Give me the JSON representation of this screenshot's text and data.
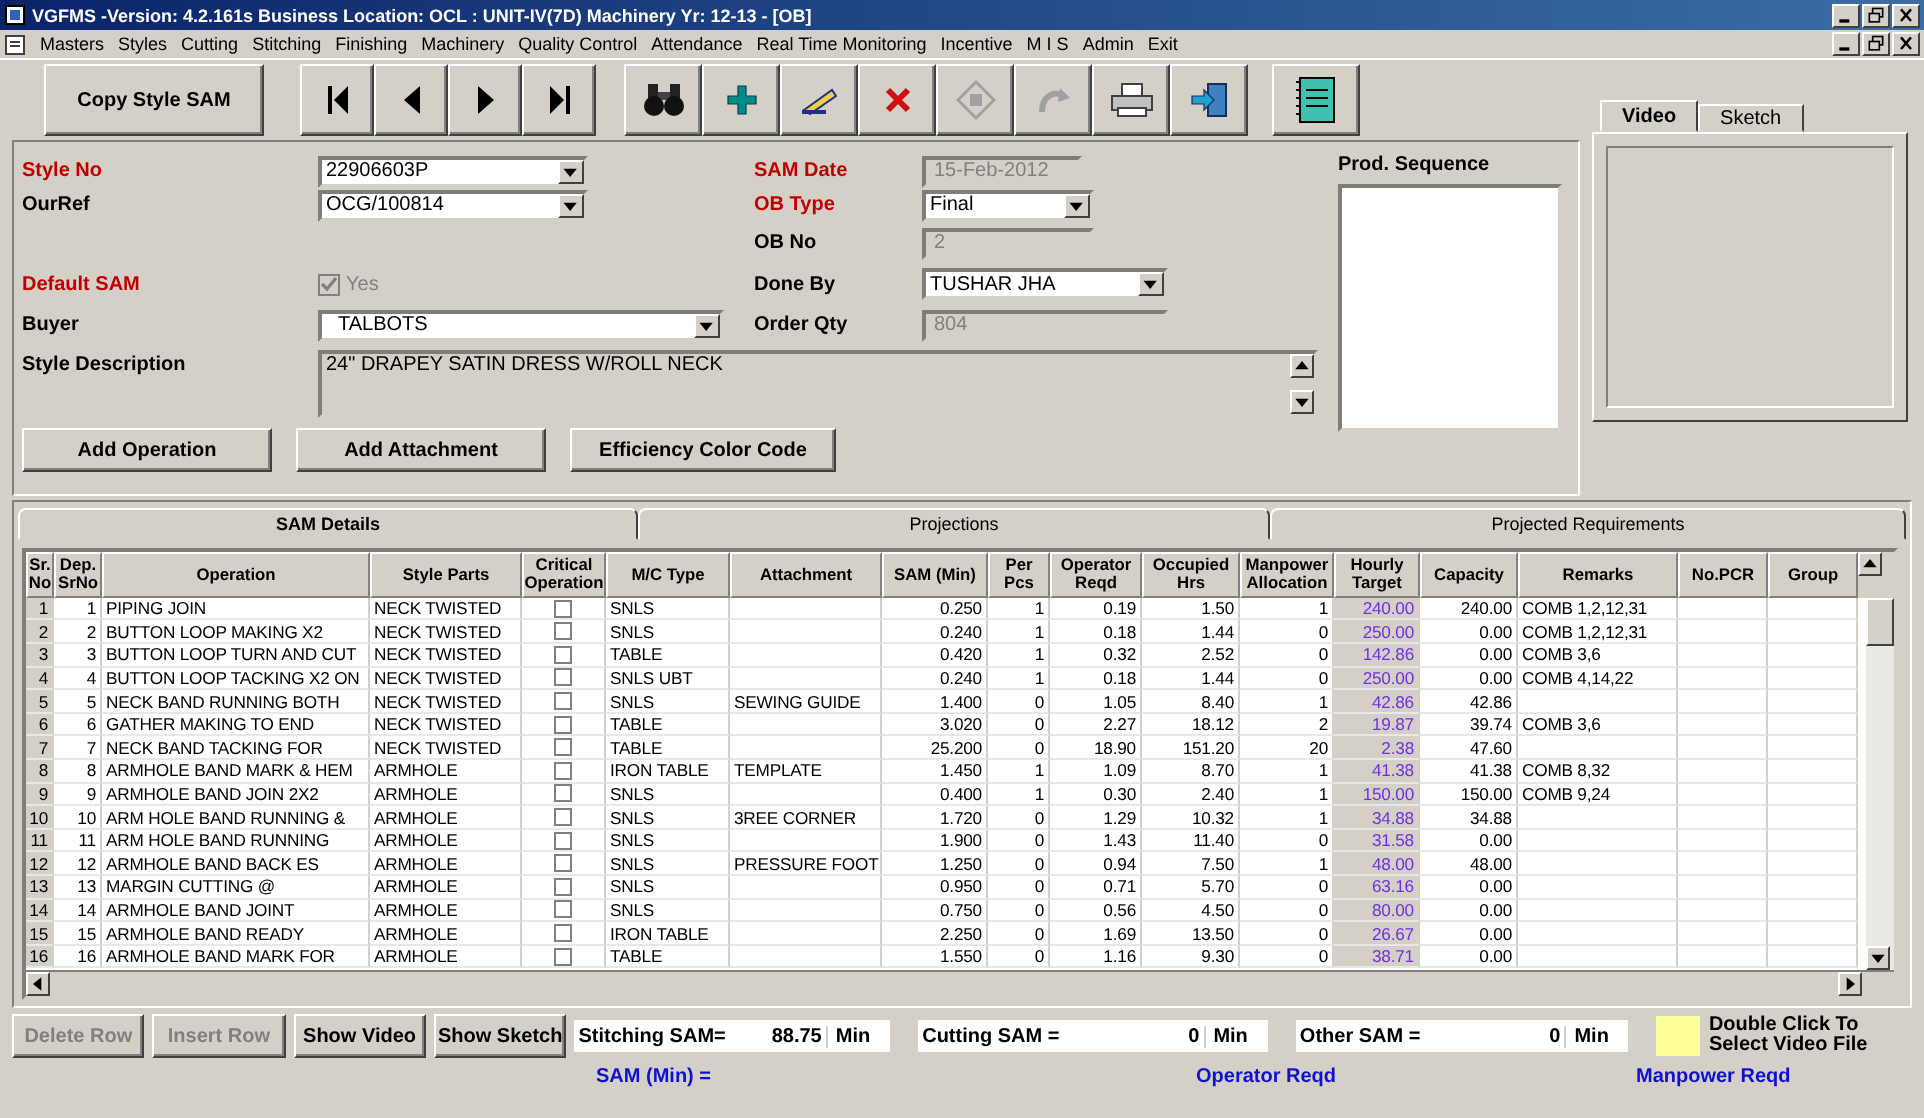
{
  "window": {
    "title": "VGFMS -Version: 4.2.161s Business Location: OCL : UNIT-IV(7D)  Machinery Yr: 12-13  - [OB]"
  },
  "menu": [
    "Masters",
    "Styles",
    "Cutting",
    "Stitching",
    "Finishing",
    "Machinery",
    "Quality Control",
    "Attendance",
    "Real Time Monitoring",
    "Incentive",
    "M I S",
    "Admin",
    "Exit"
  ],
  "toolbar": {
    "copy_button": "Copy Style SAM",
    "nav": [
      {
        "kind": "first"
      },
      {
        "kind": "prev"
      },
      {
        "kind": "next"
      },
      {
        "kind": "last"
      }
    ],
    "tools": [
      {
        "kind": "find",
        "disabled": false
      },
      {
        "kind": "add",
        "disabled": false
      },
      {
        "kind": "edit",
        "disabled": false
      },
      {
        "kind": "delete",
        "disabled": false
      },
      {
        "kind": "save",
        "disabled": true
      },
      {
        "kind": "undo",
        "disabled": true
      },
      {
        "kind": "print",
        "disabled": false
      },
      {
        "kind": "exit",
        "disabled": false
      }
    ],
    "notes": {
      "kind": "notes"
    }
  },
  "form": {
    "style_no": {
      "label": "Style No",
      "required": true,
      "value": "22906603P"
    },
    "our_ref": {
      "label": "OurRef",
      "required": false,
      "value": "OCG/100814"
    },
    "default_sam": {
      "label": "Default SAM",
      "required": true,
      "checkbox_label": "Yes",
      "checked": true,
      "disabled": true
    },
    "buyer": {
      "label": "Buyer",
      "required": false,
      "value": "TALBOTS"
    },
    "style_description": {
      "label": "Style Description",
      "value": "24\" DRAPEY SATIN DRESS W/ROLL NECK"
    },
    "sam_date": {
      "label": "SAM Date",
      "required": true,
      "value": "15-Feb-2012",
      "disabled": true
    },
    "ob_type": {
      "label": "OB Type",
      "required": true,
      "value": "Final"
    },
    "ob_no": {
      "label": "OB No",
      "required": false,
      "value": "2",
      "disabled": true
    },
    "done_by": {
      "label": "Done By",
      "required": false,
      "value": "TUSHAR JHA"
    },
    "order_qty": {
      "label": "Order Qty",
      "required": false,
      "value": "804",
      "disabled": true
    },
    "prod_sequence": {
      "label": "Prod. Sequence"
    },
    "buttons": [
      "Add Operation",
      "Add Attachment",
      "Efficiency Color Code"
    ]
  },
  "media_tabs": [
    {
      "label": "Video",
      "selected": true
    },
    {
      "label": "Sketch",
      "selected": false
    }
  ],
  "grid_tabs": [
    {
      "label": "SAM Details",
      "selected": true
    },
    {
      "label": "Projections",
      "selected": false
    },
    {
      "label": "Projected Requirements",
      "selected": false
    }
  ],
  "table": {
    "columns": [
      "Sr. No",
      "Dep. SrNo",
      "Operation",
      "Style Parts",
      "Critical Operation",
      "M/C Type",
      "Attachment",
      "SAM (Min)",
      "Per Pcs",
      "Operator Reqd",
      "Occupied Hrs",
      "Manpower Allocation",
      "Hourly Target",
      "Capacity",
      "Remarks",
      "No.PCR",
      "Group"
    ],
    "rows": [
      {
        "sr": "1",
        "dep": "1",
        "operation": "PIPING JOIN",
        "style_parts": "NECK TWISTED",
        "critical": false,
        "mc_type": "SNLS",
        "attachment": "",
        "sam": "0.250",
        "per_pcs": "1",
        "operator_reqd": "0.19",
        "occupied_hrs": "1.50",
        "manpower": "1",
        "hourly_target": "240.00",
        "capacity": "240.00",
        "remarks": "COMB 1,2,12,31"
      },
      {
        "sr": "2",
        "dep": "2",
        "operation": "BUTTON LOOP MAKING X2",
        "style_parts": "NECK TWISTED",
        "critical": false,
        "mc_type": "SNLS",
        "attachment": "",
        "sam": "0.240",
        "per_pcs": "1",
        "operator_reqd": "0.18",
        "occupied_hrs": "1.44",
        "manpower": "0",
        "hourly_target": "250.00",
        "capacity": "0.00",
        "remarks": "COMB 1,2,12,31"
      },
      {
        "sr": "3",
        "dep": "3",
        "operation": "BUTTON LOOP TURN AND CUT",
        "style_parts": "NECK TWISTED",
        "critical": false,
        "mc_type": "TABLE",
        "attachment": "",
        "sam": "0.420",
        "per_pcs": "1",
        "operator_reqd": "0.32",
        "occupied_hrs": "2.52",
        "manpower": "0",
        "hourly_target": "142.86",
        "capacity": "0.00",
        "remarks": "COMB 3,6"
      },
      {
        "sr": "4",
        "dep": "4",
        "operation": "BUTTON LOOP TACKING X2 ON",
        "style_parts": "NECK TWISTED",
        "critical": false,
        "mc_type": "SNLS UBT",
        "attachment": "",
        "sam": "0.240",
        "per_pcs": "1",
        "operator_reqd": "0.18",
        "occupied_hrs": "1.44",
        "manpower": "0",
        "hourly_target": "250.00",
        "capacity": "0.00",
        "remarks": "COMB 4,14,22"
      },
      {
        "sr": "5",
        "dep": "5",
        "operation": "NECK BAND RUNNING BOTH",
        "style_parts": "NECK TWISTED",
        "critical": false,
        "mc_type": "SNLS",
        "attachment": "SEWING GUIDE",
        "sam": "1.400",
        "per_pcs": "0",
        "operator_reqd": "1.05",
        "occupied_hrs": "8.40",
        "manpower": "1",
        "hourly_target": "42.86",
        "capacity": "42.86",
        "remarks": ""
      },
      {
        "sr": "6",
        "dep": "6",
        "operation": "GATHER MAKING TO END",
        "style_parts": "NECK TWISTED",
        "critical": false,
        "mc_type": "TABLE",
        "attachment": "",
        "sam": "3.020",
        "per_pcs": "0",
        "operator_reqd": "2.27",
        "occupied_hrs": "18.12",
        "manpower": "2",
        "hourly_target": "19.87",
        "capacity": "39.74",
        "remarks": "COMB 3,6"
      },
      {
        "sr": "7",
        "dep": "7",
        "operation": "NECK BAND TACKING FOR",
        "style_parts": "NECK TWISTED",
        "critical": false,
        "mc_type": "TABLE",
        "attachment": "",
        "sam": "25.200",
        "per_pcs": "0",
        "operator_reqd": "18.90",
        "occupied_hrs": "151.20",
        "manpower": "20",
        "hourly_target": "2.38",
        "capacity": "47.60",
        "remarks": ""
      },
      {
        "sr": "8",
        "dep": "8",
        "operation": "ARMHOLE BAND MARK & HEM",
        "style_parts": "ARMHOLE",
        "critical": false,
        "mc_type": "IRON TABLE",
        "attachment": "TEMPLATE",
        "sam": "1.450",
        "per_pcs": "1",
        "operator_reqd": "1.09",
        "occupied_hrs": "8.70",
        "manpower": "1",
        "hourly_target": "41.38",
        "capacity": "41.38",
        "remarks": "COMB 8,32"
      },
      {
        "sr": "9",
        "dep": "9",
        "operation": "ARMHOLE BAND JOIN 2X2",
        "style_parts": "ARMHOLE",
        "critical": false,
        "mc_type": "SNLS",
        "attachment": "",
        "sam": "0.400",
        "per_pcs": "1",
        "operator_reqd": "0.30",
        "occupied_hrs": "2.40",
        "manpower": "1",
        "hourly_target": "150.00",
        "capacity": "150.00",
        "remarks": "COMB 9,24"
      },
      {
        "sr": "10",
        "dep": "10",
        "operation": "ARM HOLE BAND RUNNING &",
        "style_parts": "ARMHOLE",
        "critical": false,
        "mc_type": "SNLS",
        "attachment": "3REE CORNER",
        "sam": "1.720",
        "per_pcs": "0",
        "operator_reqd": "1.29",
        "occupied_hrs": "10.32",
        "manpower": "1",
        "hourly_target": "34.88",
        "capacity": "34.88",
        "remarks": ""
      },
      {
        "sr": "11",
        "dep": "11",
        "operation": "ARM HOLE BAND RUNNING",
        "style_parts": "ARMHOLE",
        "critical": false,
        "mc_type": "SNLS",
        "attachment": "",
        "sam": "1.900",
        "per_pcs": "0",
        "operator_reqd": "1.43",
        "occupied_hrs": "11.40",
        "manpower": "0",
        "hourly_target": "31.58",
        "capacity": "0.00",
        "remarks": ""
      },
      {
        "sr": "12",
        "dep": "12",
        "operation": "ARMHOLE BAND BACK ES",
        "style_parts": "ARMHOLE",
        "critical": false,
        "mc_type": "SNLS",
        "attachment": "PRESSURE FOOT",
        "sam": "1.250",
        "per_pcs": "0",
        "operator_reqd": "0.94",
        "occupied_hrs": "7.50",
        "manpower": "1",
        "hourly_target": "48.00",
        "capacity": "48.00",
        "remarks": ""
      },
      {
        "sr": "13",
        "dep": "13",
        "operation": "MARGIN CUTTING @",
        "style_parts": "ARMHOLE",
        "critical": false,
        "mc_type": "SNLS",
        "attachment": "",
        "sam": "0.950",
        "per_pcs": "0",
        "operator_reqd": "0.71",
        "occupied_hrs": "5.70",
        "manpower": "0",
        "hourly_target": "63.16",
        "capacity": "0.00",
        "remarks": ""
      },
      {
        "sr": "14",
        "dep": "14",
        "operation": "ARMHOLE BAND  JOINT",
        "style_parts": "ARMHOLE",
        "critical": false,
        "mc_type": "SNLS",
        "attachment": "",
        "sam": "0.750",
        "per_pcs": "0",
        "operator_reqd": "0.56",
        "occupied_hrs": "4.50",
        "manpower": "0",
        "hourly_target": "80.00",
        "capacity": "0.00",
        "remarks": ""
      },
      {
        "sr": "15",
        "dep": "15",
        "operation": "ARMHOLE BAND READY",
        "style_parts": "ARMHOLE",
        "critical": false,
        "mc_type": "IRON TABLE",
        "attachment": "",
        "sam": "2.250",
        "per_pcs": "0",
        "operator_reqd": "1.69",
        "occupied_hrs": "13.50",
        "manpower": "0",
        "hourly_target": "26.67",
        "capacity": "0.00",
        "remarks": ""
      },
      {
        "sr": "16",
        "dep": "16",
        "operation": "ARMHOLE BAND MARK FOR",
        "style_parts": "ARMHOLE",
        "critical": false,
        "mc_type": "TABLE",
        "attachment": "",
        "sam": "1.550",
        "per_pcs": "0",
        "operator_reqd": "1.16",
        "occupied_hrs": "9.30",
        "manpower": "0",
        "hourly_target": "38.71",
        "capacity": "0.00",
        "remarks": ""
      }
    ]
  },
  "bottom": {
    "buttons": [
      {
        "label": "Delete Row",
        "disabled": true
      },
      {
        "label": "Insert Row",
        "disabled": true
      },
      {
        "label": "Show Video",
        "disabled": false
      },
      {
        "label": "Show Sketch",
        "disabled": false
      }
    ],
    "totals": [
      {
        "label": "Stitching SAM=",
        "value": "88.75",
        "unit": "Min"
      },
      {
        "label": "Cutting SAM =",
        "value": "0",
        "unit": "Min"
      },
      {
        "label": "Other SAM =",
        "value": "0",
        "unit": "Min"
      }
    ],
    "video_hint": "Double Click To Select Video File",
    "footer_labels": [
      "SAM (Min) =",
      "Operator Reqd",
      "Manpower Reqd"
    ]
  }
}
